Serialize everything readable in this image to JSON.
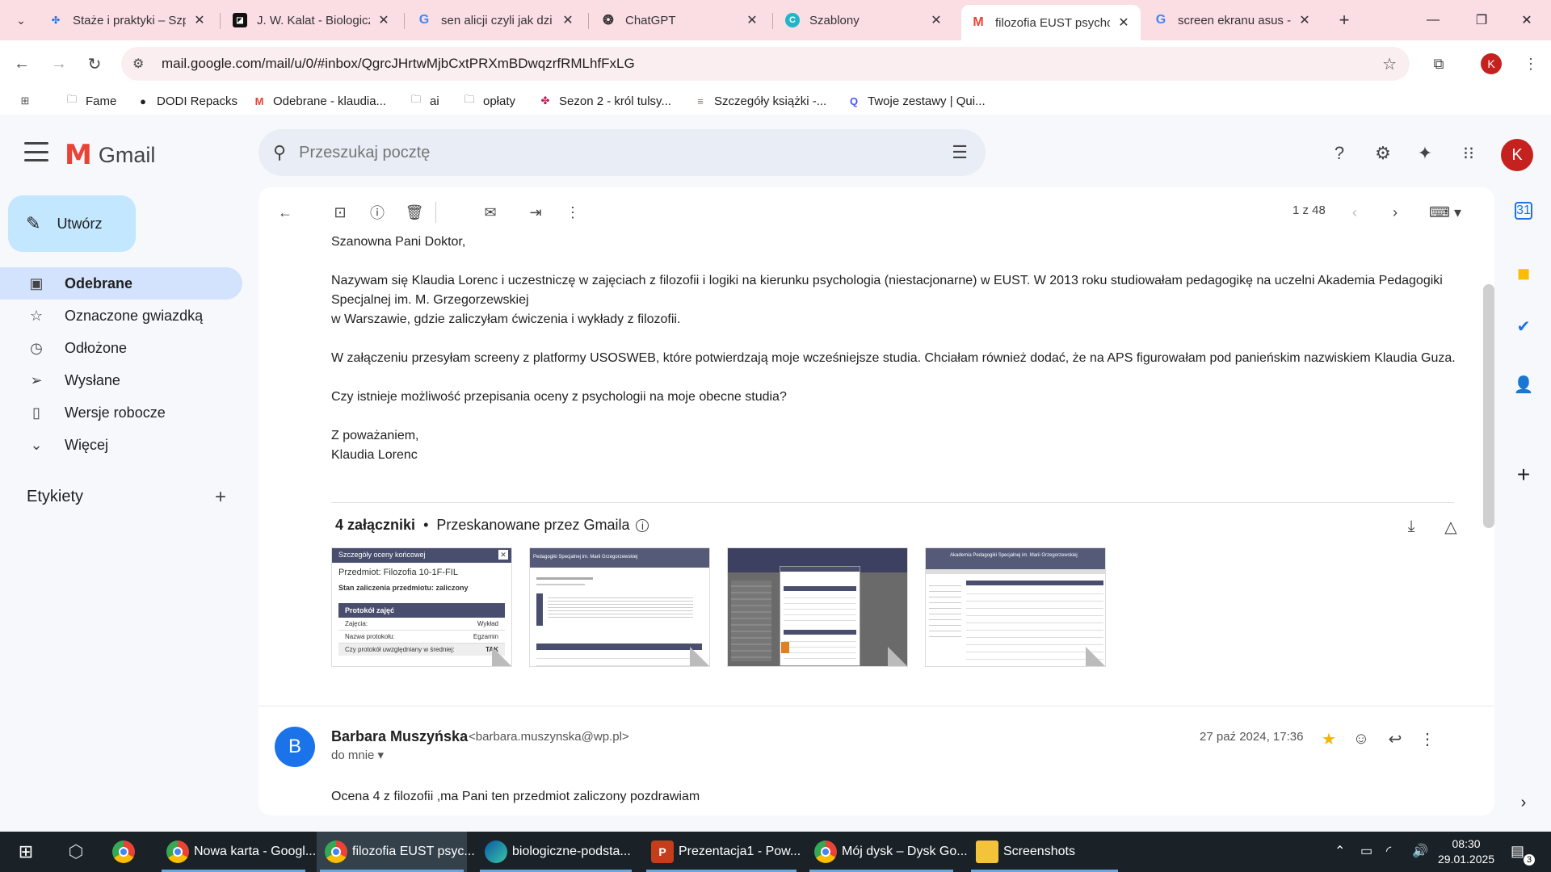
{
  "browser": {
    "tabs": [
      {
        "title": "Staże i praktyki – Szp",
        "icon": "pinwheel-icon"
      },
      {
        "title": "J. W. Kalat - Biologicz",
        "icon": "square-logo-icon"
      },
      {
        "title": "sen alicji czyli jak dzi",
        "icon": "google-icon"
      },
      {
        "title": "ChatGPT",
        "icon": "chatgpt-icon"
      },
      {
        "title": "Szablony",
        "icon": "canva-icon"
      },
      {
        "title": "filozofia EUST psycho",
        "icon": "gmail-icon",
        "active": true
      },
      {
        "title": "screen ekranu asus -",
        "icon": "google-icon"
      }
    ],
    "url": "mail.google.com/mail/u/0/#inbox/QgrcJHrtwMjbCxtPRXmBDwqzrfRMLhfFxLG",
    "profile_initial": "K",
    "bookmarks": [
      "Fame",
      "DODI Repacks",
      "Odebrane - klaudia...",
      "ai",
      "opłaty",
      "Sezon 2 - król tulsy...",
      "Szczegóły książki -...",
      "Twoje zestawy | Qui..."
    ]
  },
  "gmail": {
    "logo_text": "Gmail",
    "search_placeholder": "Przeszukaj pocztę",
    "avatar_initial": "K",
    "compose_label": "Utwórz",
    "nav": [
      {
        "label": "Odebrane",
        "icon": "inbox-icon",
        "active": true
      },
      {
        "label": "Oznaczone gwiazdką",
        "icon": "star-icon"
      },
      {
        "label": "Odłożone",
        "icon": "clock-icon"
      },
      {
        "label": "Wysłane",
        "icon": "send-icon"
      },
      {
        "label": "Wersje robocze",
        "icon": "draft-icon"
      },
      {
        "label": "Więcej",
        "icon": "chevron-down-icon"
      }
    ],
    "labels_header": "Etykiety",
    "pager": "1 z 48"
  },
  "message": {
    "greeting": "Szanowna Pani Doktor,",
    "paragraph1_a": "Nazywam się Klaudia Lorenc i uczestniczę w zajęciach z filozofii i logiki na kierunku psychologia (niestacjonarne) w EUST. W 2013 roku studiowałam pedagogikę na uczelni Akademia Pedagogiki Specjalnej im. M. Grzegorzewskiej",
    "paragraph1_b": "w Warszawie, gdzie zaliczyłam ćwiczenia i wykłady z filozofii.",
    "paragraph2": "W załączeniu przesyłam screeny z platformy USOSWEB, które potwierdzają moje wcześniejsze studia. Chciałam również dodać, że na APS figurowałam pod panieńskim nazwiskiem Klaudia Guza.",
    "paragraph3": "Czy istnieje możliwość przepisania oceny z psychologii na moje obecne studia?",
    "closing": "Z poważaniem,",
    "signature": "Klaudia Lorenc",
    "attachments_count": "4 załączniki",
    "attachments_scanned": "Przeskanowane przez Gmaila",
    "thumb1": {
      "title": "Szczegóły oceny końcowej",
      "subject": "Przedmiot: Filozofia 10-1F-FIL",
      "status": "Stan zaliczenia przedmiotu: zaliczony",
      "section": "Protokół zajęć",
      "rows": [
        [
          "Zajęcia:",
          "Wykład"
        ],
        [
          "Nazwa protokołu:",
          "Egzamin"
        ],
        [
          "Czy protokół uwzględniany w średniej:",
          "TAK"
        ]
      ]
    },
    "thumb2_header": "Pedagogiki Specjalnej im. Marii Grzegorzewskiej",
    "thumb4_header": "Akademia Pedagogiki Specjalnej im. Marii Grzegorzewskiej"
  },
  "reply": {
    "sender_initial": "B",
    "sender_name": "Barbara Muszyńska",
    "sender_email": "<barbara.muszynska@wp.pl>",
    "to": "do mnie",
    "date": "27 paź 2024, 17:36",
    "text": "Ocena 4 z filozofii ,ma Pani ten przedmiot zaliczony pozdrawiam"
  },
  "taskbar": {
    "apps": [
      {
        "label": "Nowa karta - Googl..."
      },
      {
        "label": "filozofia EUST psyc...",
        "active": true
      },
      {
        "label": "biologiczne-podsta..."
      },
      {
        "label": "Prezentacja1 - Pow..."
      },
      {
        "label": "Mój dysk – Dysk Go..."
      },
      {
        "label": "Screenshots"
      }
    ],
    "time": "08:30",
    "date": "29.01.2025",
    "notifications": "3"
  }
}
